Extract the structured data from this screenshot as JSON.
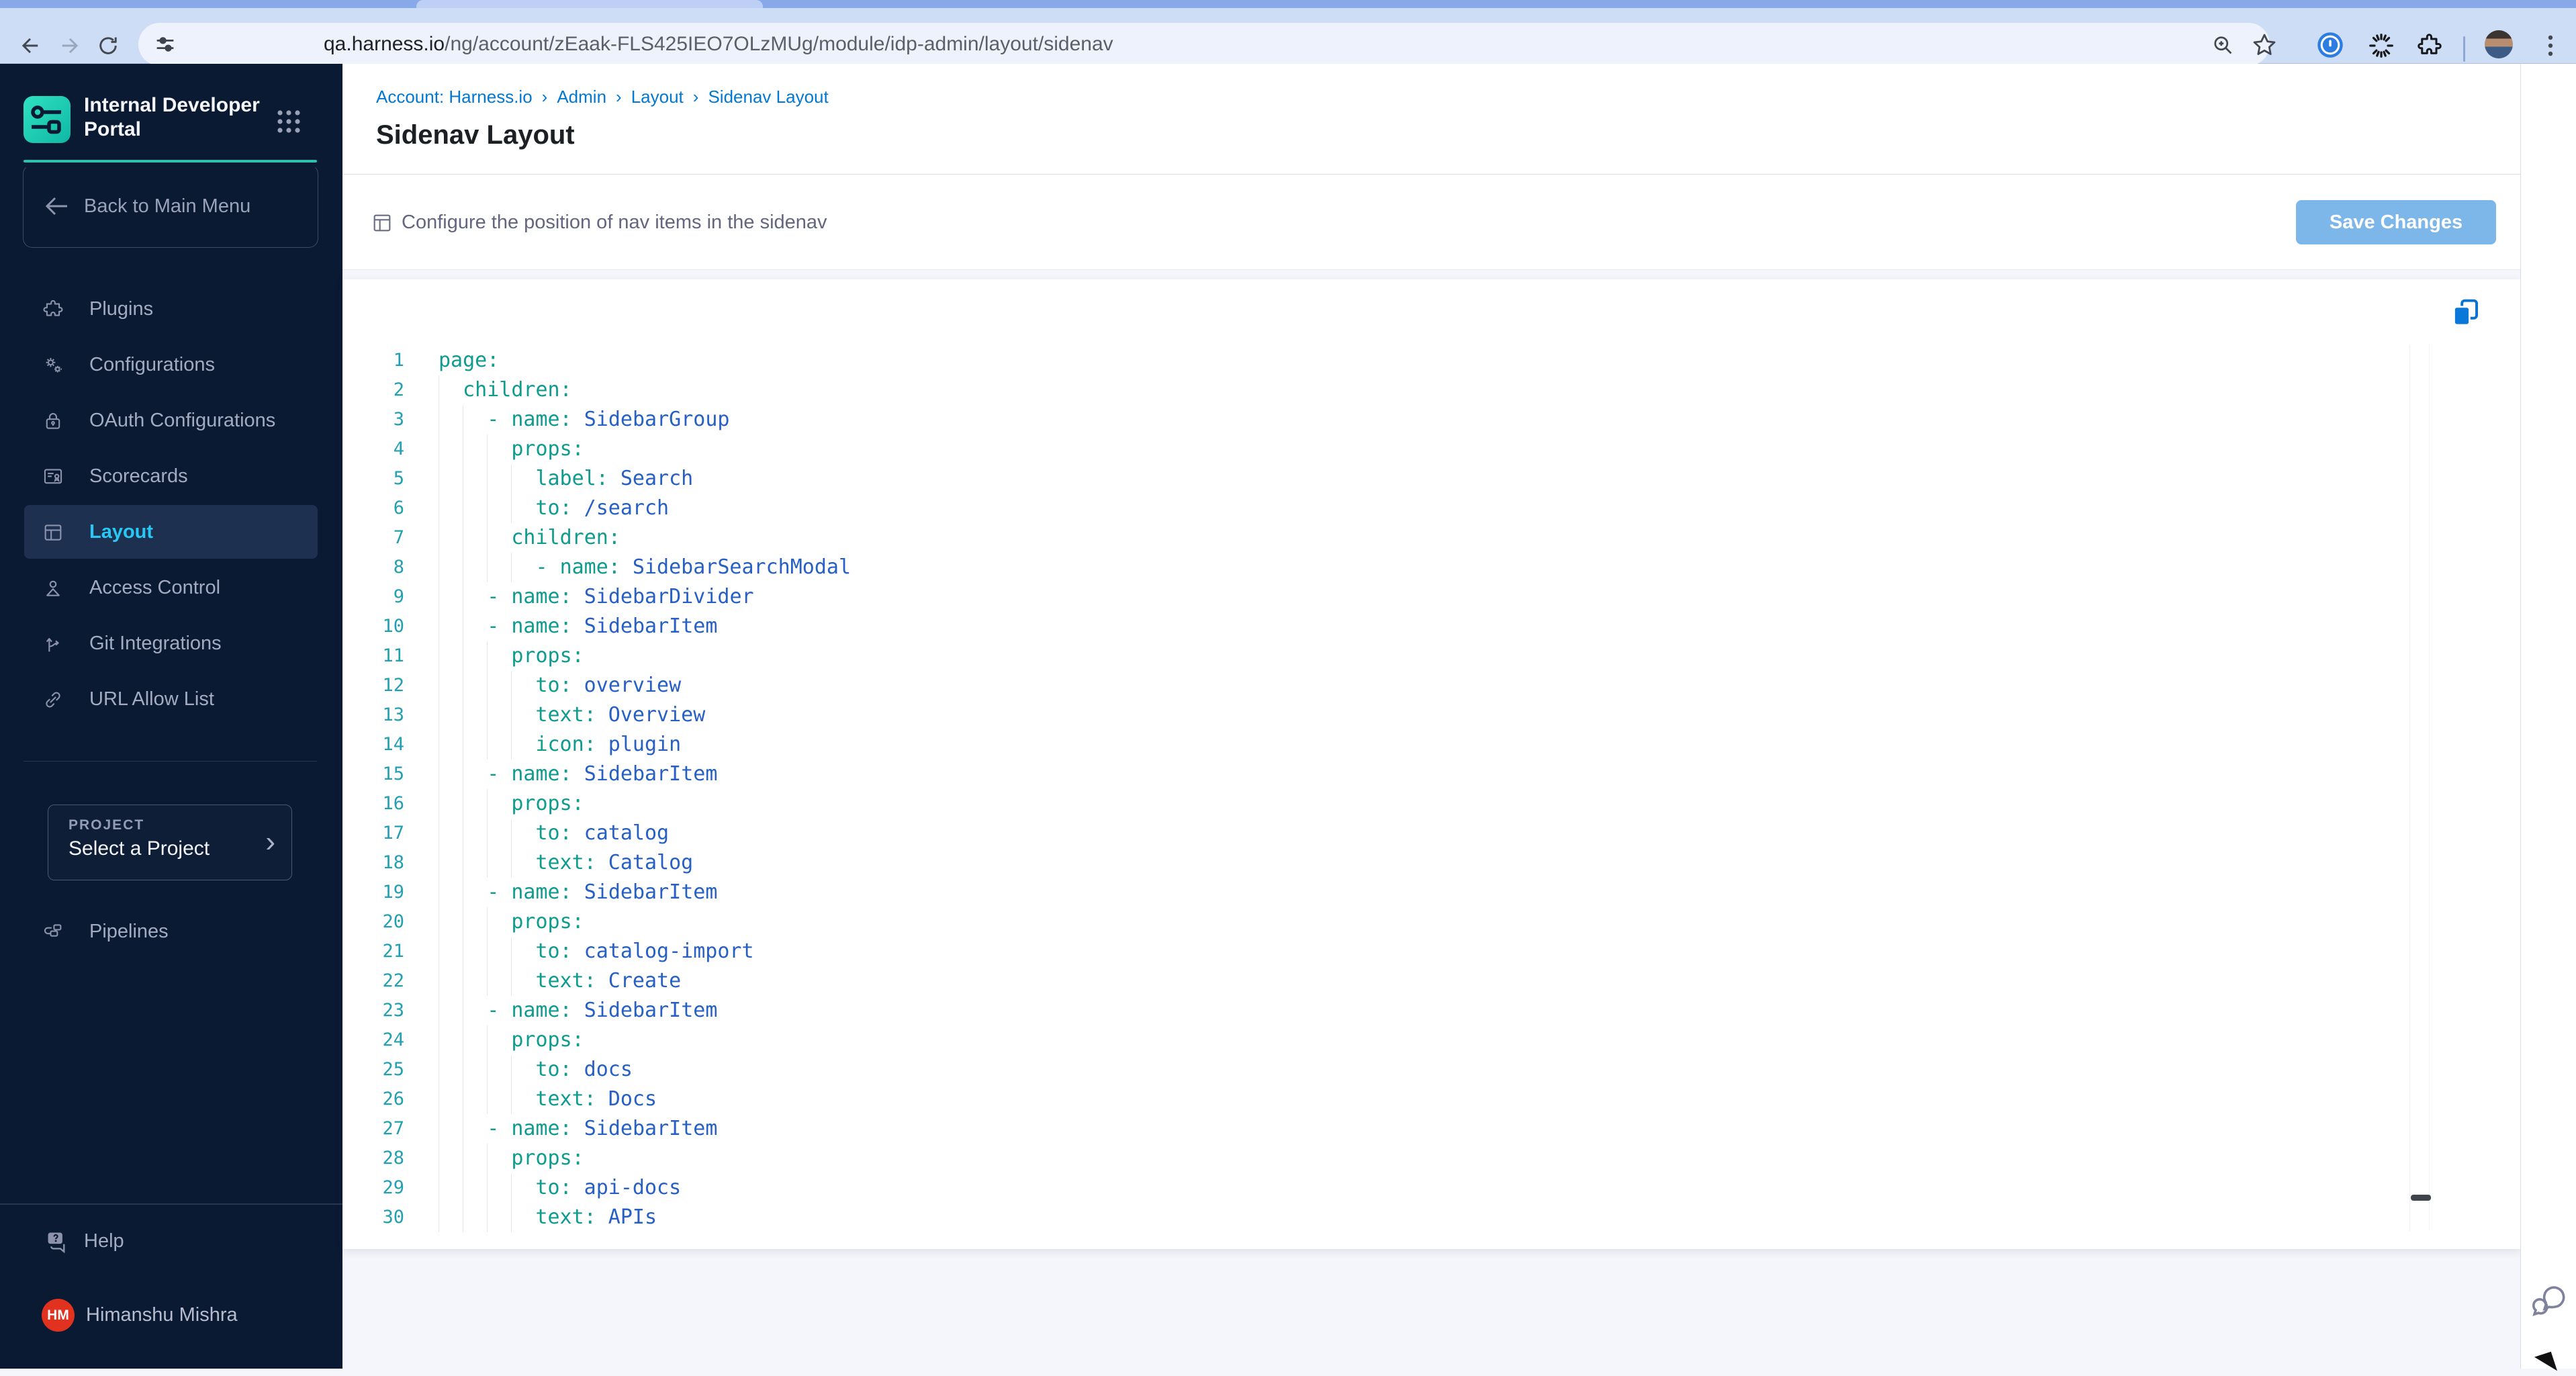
{
  "browser": {
    "url": {
      "domain": "qa.harness.io",
      "path": "/ng/account/zEaak-FLS425IEO7OLzMUg/module/idp-admin/layout/sidenav"
    }
  },
  "sidebar": {
    "product_title_line1": "Internal Developer",
    "product_title_line2": "Portal",
    "back_label": "Back to Main Menu",
    "nav_items": [
      {
        "label": "Plugins",
        "icon": "plugin-icon",
        "selected": false
      },
      {
        "label": "Configurations",
        "icon": "gears-icon",
        "selected": false
      },
      {
        "label": "OAuth Configurations",
        "icon": "lock-icon",
        "selected": false
      },
      {
        "label": "Scorecards",
        "icon": "scorecard-icon",
        "selected": false
      },
      {
        "label": "Layout",
        "icon": "layout-icon",
        "selected": true
      },
      {
        "label": "Access Control",
        "icon": "person-icon",
        "selected": false
      },
      {
        "label": "Git Integrations",
        "icon": "fork-icon",
        "selected": false
      },
      {
        "label": "URL Allow List",
        "icon": "link-icon",
        "selected": false
      }
    ],
    "project_section": {
      "label": "PROJECT",
      "value": "Select a Project"
    },
    "pipelines_label": "Pipelines",
    "help_label": "Help",
    "user": {
      "initials": "HM",
      "name": "Himanshu Mishra"
    }
  },
  "header": {
    "breadcrumb": [
      "Account: Harness.io",
      "Admin",
      "Layout",
      "Sidenav Layout"
    ],
    "title": "Sidenav Layout"
  },
  "toolbar": {
    "hint": "Configure the position of nav items in the sidenav",
    "save_label": "Save Changes"
  },
  "editor": {
    "language": "yaml",
    "lines": [
      {
        "indent": 0,
        "dash": false,
        "key": "page",
        "value": null
      },
      {
        "indent": 2,
        "dash": false,
        "key": "children",
        "value": null
      },
      {
        "indent": 4,
        "dash": true,
        "key": "name",
        "value": "SidebarGroup"
      },
      {
        "indent": 6,
        "dash": false,
        "key": "props",
        "value": null
      },
      {
        "indent": 8,
        "dash": false,
        "key": "label",
        "value": "Search"
      },
      {
        "indent": 8,
        "dash": false,
        "key": "to",
        "value": "/search"
      },
      {
        "indent": 6,
        "dash": false,
        "key": "children",
        "value": null
      },
      {
        "indent": 8,
        "dash": true,
        "key": "name",
        "value": "SidebarSearchModal"
      },
      {
        "indent": 4,
        "dash": true,
        "key": "name",
        "value": "SidebarDivider"
      },
      {
        "indent": 4,
        "dash": true,
        "key": "name",
        "value": "SidebarItem"
      },
      {
        "indent": 6,
        "dash": false,
        "key": "props",
        "value": null
      },
      {
        "indent": 8,
        "dash": false,
        "key": "to",
        "value": "overview"
      },
      {
        "indent": 8,
        "dash": false,
        "key": "text",
        "value": "Overview"
      },
      {
        "indent": 8,
        "dash": false,
        "key": "icon",
        "value": "plugin"
      },
      {
        "indent": 4,
        "dash": true,
        "key": "name",
        "value": "SidebarItem"
      },
      {
        "indent": 6,
        "dash": false,
        "key": "props",
        "value": null
      },
      {
        "indent": 8,
        "dash": false,
        "key": "to",
        "value": "catalog"
      },
      {
        "indent": 8,
        "dash": false,
        "key": "text",
        "value": "Catalog"
      },
      {
        "indent": 4,
        "dash": true,
        "key": "name",
        "value": "SidebarItem"
      },
      {
        "indent": 6,
        "dash": false,
        "key": "props",
        "value": null
      },
      {
        "indent": 8,
        "dash": false,
        "key": "to",
        "value": "catalog-import"
      },
      {
        "indent": 8,
        "dash": false,
        "key": "text",
        "value": "Create"
      },
      {
        "indent": 4,
        "dash": true,
        "key": "name",
        "value": "SidebarItem"
      },
      {
        "indent": 6,
        "dash": false,
        "key": "props",
        "value": null
      },
      {
        "indent": 8,
        "dash": false,
        "key": "to",
        "value": "docs"
      },
      {
        "indent": 8,
        "dash": false,
        "key": "text",
        "value": "Docs"
      },
      {
        "indent": 4,
        "dash": true,
        "key": "name",
        "value": "SidebarItem"
      },
      {
        "indent": 6,
        "dash": false,
        "key": "props",
        "value": null
      },
      {
        "indent": 8,
        "dash": false,
        "key": "to",
        "value": "api-docs"
      },
      {
        "indent": 8,
        "dash": false,
        "key": "text",
        "value": "APIs"
      }
    ]
  },
  "colors": {
    "accent_teal": "#2cc2a9",
    "breadcrumb_blue": "#0278d5",
    "selected_cyan": "#29c7f6",
    "yaml_key": "#0f9b8e",
    "yaml_value": "#2760c4",
    "line_number": "#229fb1",
    "save_button": "#7db7ea",
    "avatar_red": "#e0321f"
  }
}
